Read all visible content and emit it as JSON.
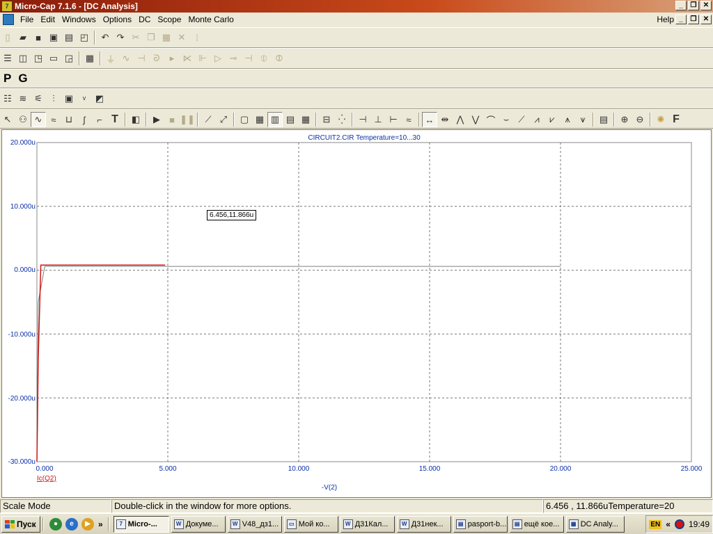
{
  "window": {
    "title": "Micro-Cap 7.1.6 - [DC Analysis]",
    "app_icon_text": "7",
    "minimize_glyph": "_",
    "restore_glyph": "❐",
    "close_glyph": "✕"
  },
  "menu": {
    "items": [
      "File",
      "Edit",
      "Windows",
      "Options",
      "DC",
      "Scope",
      "Monte Carlo"
    ],
    "help": "Help"
  },
  "toolbar3": {
    "p_label": "P",
    "g_label": "G"
  },
  "toolbar5": {
    "text_tool": "T",
    "format_tool": "F"
  },
  "plot": {
    "title": "CIRCUIT2.CIR Temperature=10...30",
    "y_ticks": [
      "20.000u",
      "10.000u",
      "0.000u",
      "-10.000u",
      "-20.000u",
      "-30.000u"
    ],
    "x_ticks": [
      "0.000",
      "5.000",
      "10.000",
      "15.000",
      "20.000",
      "25.000"
    ],
    "x_axis_label": "-V(2)",
    "series_name": "Ic(Q2)",
    "cursor_readout": "6.456,11.866u",
    "trace_color": "#d21414",
    "axis_color": "#0a2fa8"
  },
  "chart_data": {
    "type": "line",
    "title": "CIRCUIT2.CIR Temperature=10...30",
    "xlabel": "-V(2)",
    "ylabel": "",
    "xlim": [
      0,
      25
    ],
    "ylim": [
      -30,
      20
    ],
    "y_unit": "u",
    "grid": true,
    "series": [
      {
        "name": "Ic(Q2)",
        "color": "#d21414",
        "x": [
          0,
          0.02,
          0.05,
          0.15,
          0.3,
          4.9
        ],
        "y": [
          -30,
          -24,
          -14,
          0.8,
          0.8,
          0.8
        ]
      },
      {
        "color": "#7f7f7f",
        "x": [
          0,
          0.05,
          0.3,
          20
        ],
        "y": [
          -30,
          -5,
          0.6,
          0.6
        ]
      }
    ]
  },
  "status": {
    "mode": "Scale Mode",
    "hint": "Double-click in the window for more options.",
    "readout": "6.456 , 11.866uTemperature=20"
  },
  "taskbar": {
    "start": "Пуск",
    "chevron": "»",
    "tasks": [
      {
        "label": "Micro-...",
        "active": true
      },
      {
        "label": "Докуме...",
        "active": false
      },
      {
        "label": "V48_дз1...",
        "active": false
      },
      {
        "label": "Мой ко...",
        "active": false
      },
      {
        "label": "Д31Кал...",
        "active": false
      },
      {
        "label": "Д31нек...",
        "active": false
      },
      {
        "label": "pasport-b...",
        "active": false
      },
      {
        "label": "ещё кое...",
        "active": false
      },
      {
        "label": "DC Analy...",
        "active": false
      }
    ],
    "language": "EN",
    "tray_chevron": "«",
    "clock": "19:49"
  }
}
